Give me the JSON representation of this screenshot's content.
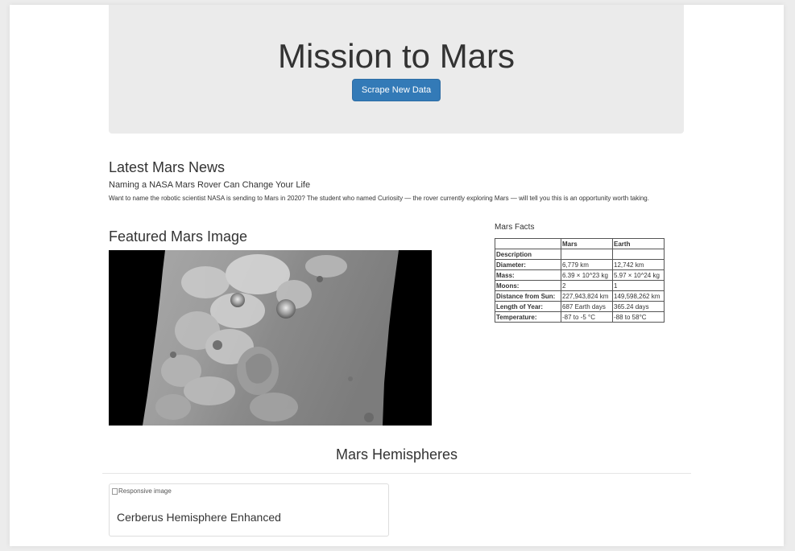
{
  "header": {
    "title": "Mission to Mars",
    "scrape_button_label": "Scrape New Data"
  },
  "news": {
    "heading": "Latest Mars News",
    "title": "Naming a NASA Mars Rover Can Change Your Life",
    "body": "Want to name the robotic scientist NASA is sending to Mars in 2020? The student who named Curiosity — the rover currently exploring Mars — will tell you this is an opportunity worth taking."
  },
  "featured": {
    "heading": "Featured Mars Image"
  },
  "facts": {
    "heading": "Mars Facts",
    "columns": [
      "",
      "Mars",
      "Earth"
    ],
    "index_label": "Description",
    "rows": [
      {
        "label": "Diameter:",
        "mars": "6,779 km",
        "earth": "12,742 km"
      },
      {
        "label": "Mass:",
        "mars": "6.39 × 10^23 kg",
        "earth": "5.97 × 10^24 kg"
      },
      {
        "label": "Moons:",
        "mars": "2",
        "earth": "1"
      },
      {
        "label": "Distance from Sun:",
        "mars": "227,943,824 km",
        "earth": "149,598,262 km"
      },
      {
        "label": "Length of Year:",
        "mars": "687 Earth days",
        "earth": "365.24 days"
      },
      {
        "label": "Temperature:",
        "mars": "-87 to -5 °C",
        "earth": "-88 to 58°C"
      }
    ]
  },
  "hemispheres": {
    "heading": "Mars Hemispheres",
    "cards": [
      {
        "img_alt": "Responsive image",
        "title": "Cerberus Hemisphere Enhanced"
      }
    ]
  },
  "colors": {
    "primary_button": "#337ab7",
    "jumbotron_bg": "#ebebeb",
    "page_bg": "#ffffff"
  }
}
